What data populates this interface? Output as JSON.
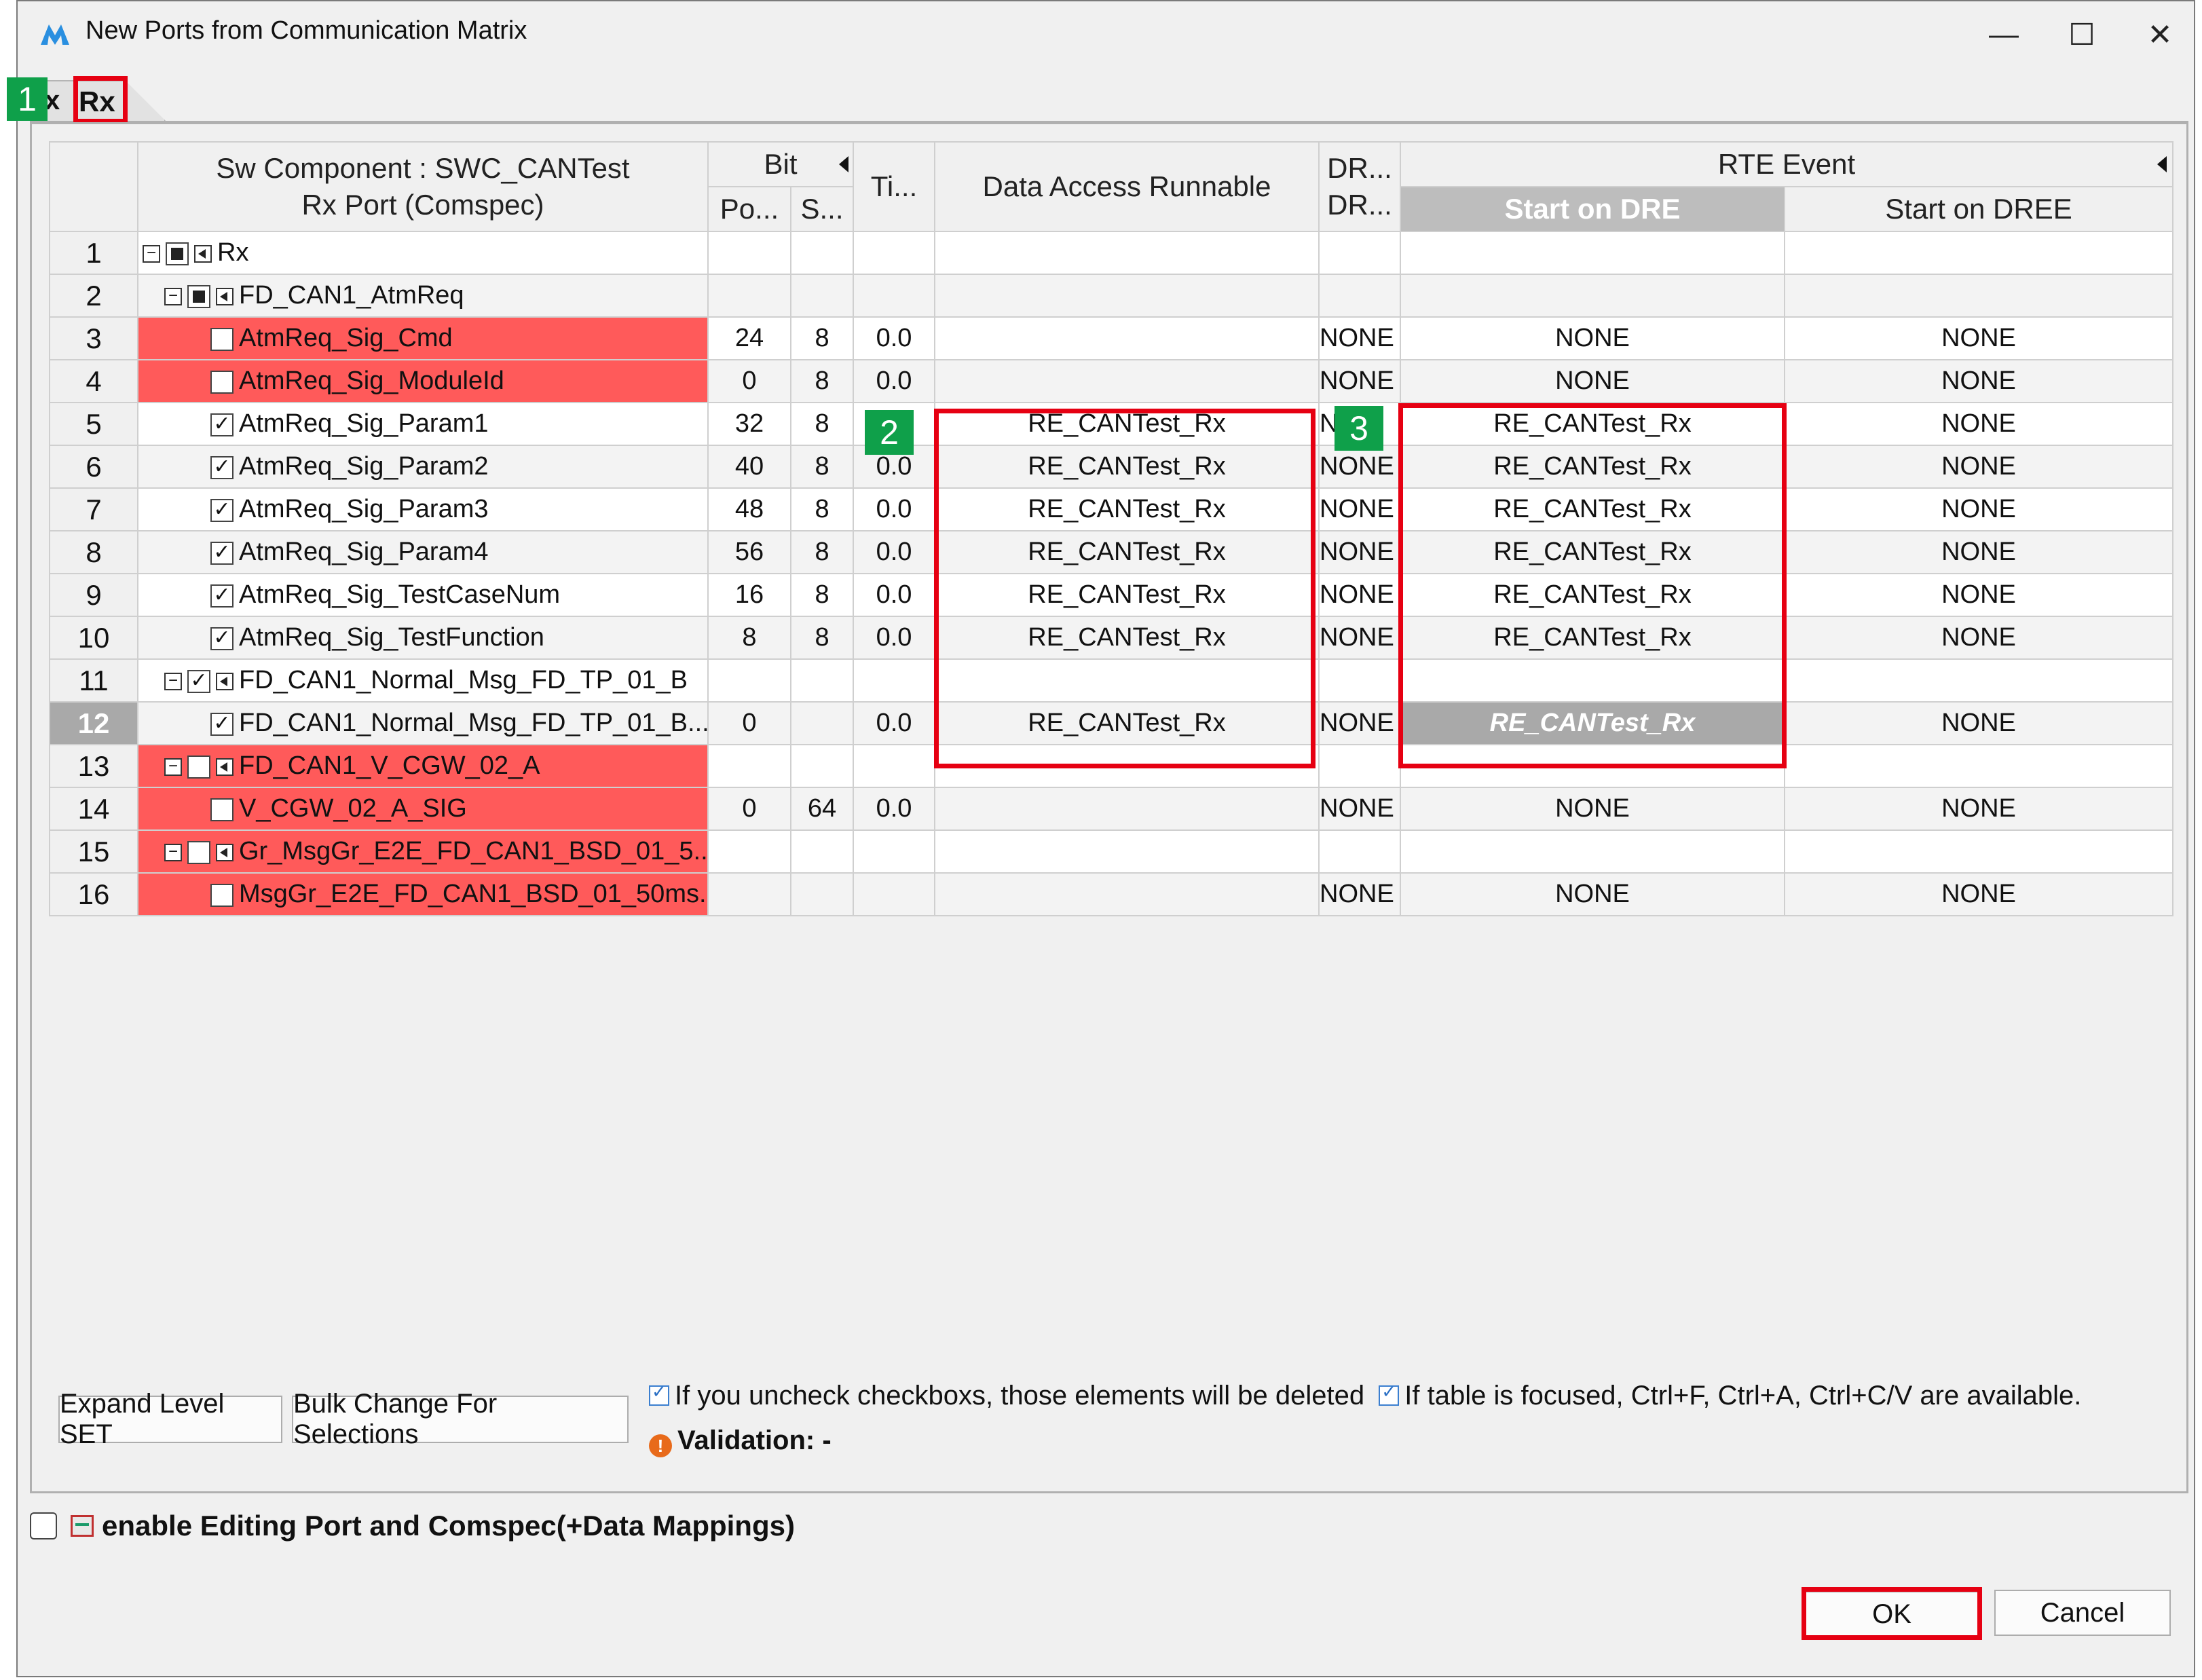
{
  "window": {
    "title": "New Ports from Communication Matrix",
    "minimize": "—",
    "maximize": "☐",
    "close": "✕"
  },
  "tabs": [
    {
      "label": "x"
    },
    {
      "label": "Rx"
    }
  ],
  "markers": [
    "1",
    "2",
    "3"
  ],
  "table": {
    "headers": {
      "component_line1": "Sw Component : SWC_CANTest",
      "component_line2": "Rx Port (Comspec)",
      "bit": "Bit",
      "bit_pos": "Po...",
      "bit_size": "S...",
      "timeout": "Ti...",
      "data_access_runnable": "Data Access Runnable",
      "dr_line1": "DR...",
      "dr_line2": "DR...",
      "rte_event": "RTE Event",
      "start_on_dre": "Start on DRE",
      "start_on_dree": "Start on DREE"
    },
    "rows": [
      {
        "num": "1",
        "name": "Rx",
        "pos": "",
        "size": "",
        "ti": "",
        "runnable": "",
        "dr": "",
        "dre": "",
        "dree": ""
      },
      {
        "num": "2",
        "name": "FD_CAN1_AtmReq",
        "pos": "",
        "size": "",
        "ti": "",
        "runnable": "",
        "dr": "",
        "dre": "",
        "dree": ""
      },
      {
        "num": "3",
        "name": "AtmReq_Sig_Cmd",
        "pos": "24",
        "size": "8",
        "ti": "0.0",
        "runnable": "",
        "dr": "NONE",
        "dre": "NONE",
        "dree": "NONE"
      },
      {
        "num": "4",
        "name": "AtmReq_Sig_ModuleId",
        "pos": "0",
        "size": "8",
        "ti": "0.0",
        "runnable": "",
        "dr": "NONE",
        "dre": "NONE",
        "dree": "NONE"
      },
      {
        "num": "5",
        "name": "AtmReq_Sig_Param1",
        "pos": "32",
        "size": "8",
        "ti": "",
        "runnable": "RE_CANTest_Rx",
        "dr": "N",
        "dre": "RE_CANTest_Rx",
        "dree": "NONE"
      },
      {
        "num": "6",
        "name": "AtmReq_Sig_Param2",
        "pos": "40",
        "size": "8",
        "ti": "0.0",
        "runnable": "RE_CANTest_Rx",
        "dr": "NONE",
        "dre": "RE_CANTest_Rx",
        "dree": "NONE"
      },
      {
        "num": "7",
        "name": "AtmReq_Sig_Param3",
        "pos": "48",
        "size": "8",
        "ti": "0.0",
        "runnable": "RE_CANTest_Rx",
        "dr": "NONE",
        "dre": "RE_CANTest_Rx",
        "dree": "NONE"
      },
      {
        "num": "8",
        "name": "AtmReq_Sig_Param4",
        "pos": "56",
        "size": "8",
        "ti": "0.0",
        "runnable": "RE_CANTest_Rx",
        "dr": "NONE",
        "dre": "RE_CANTest_Rx",
        "dree": "NONE"
      },
      {
        "num": "9",
        "name": "AtmReq_Sig_TestCaseNum",
        "pos": "16",
        "size": "8",
        "ti": "0.0",
        "runnable": "RE_CANTest_Rx",
        "dr": "NONE",
        "dre": "RE_CANTest_Rx",
        "dree": "NONE"
      },
      {
        "num": "10",
        "name": "AtmReq_Sig_TestFunction",
        "pos": "8",
        "size": "8",
        "ti": "0.0",
        "runnable": "RE_CANTest_Rx",
        "dr": "NONE",
        "dre": "RE_CANTest_Rx",
        "dree": "NONE"
      },
      {
        "num": "11",
        "name": "FD_CAN1_Normal_Msg_FD_TP_01_B",
        "pos": "",
        "size": "",
        "ti": "",
        "runnable": "",
        "dr": "",
        "dre": "",
        "dree": ""
      },
      {
        "num": "12",
        "name": "FD_CAN1_Normal_Msg_FD_TP_01_B...",
        "pos": "0",
        "size": "",
        "ti": "0.0",
        "runnable": "RE_CANTest_Rx",
        "dr": "NONE",
        "dre": "RE_CANTest_Rx",
        "dree": "NONE"
      },
      {
        "num": "13",
        "name": "FD_CAN1_V_CGW_02_A",
        "pos": "",
        "size": "",
        "ti": "",
        "runnable": "",
        "dr": "",
        "dre": "",
        "dree": ""
      },
      {
        "num": "14",
        "name": "V_CGW_02_A_SIG",
        "pos": "0",
        "size": "64",
        "ti": "0.0",
        "runnable": "",
        "dr": "NONE",
        "dre": "NONE",
        "dree": "NONE"
      },
      {
        "num": "15",
        "name": "Gr_MsgGr_E2E_FD_CAN1_BSD_01_5...",
        "pos": "",
        "size": "",
        "ti": "",
        "runnable": "",
        "dr": "",
        "dre": "",
        "dree": ""
      },
      {
        "num": "16",
        "name": "MsgGr_E2E_FD_CAN1_BSD_01_50ms...",
        "pos": "",
        "size": "",
        "ti": "",
        "runnable": "",
        "dr": "NONE",
        "dre": "NONE",
        "dree": "NONE"
      }
    ]
  },
  "buttons": {
    "expand_level": "Expand Level SET",
    "bulk_change": "Bulk Change For Selections",
    "ok": "OK",
    "cancel": "Cancel"
  },
  "hints": {
    "uncheck": "If you uncheck checkboxs, those elements will be deleted",
    "focus": "If table is focused, Ctrl+F, Ctrl+A, Ctrl+C/V are available.",
    "validation": "Validation: -"
  },
  "enable_editing_label": "enable Editing Port and Comspec(+Data Mappings)",
  "colors": {
    "error_row": "#ff5a5a",
    "highlight_box": "#e60012",
    "marker": "#0fa04a",
    "selected": "#a9a9a9"
  }
}
